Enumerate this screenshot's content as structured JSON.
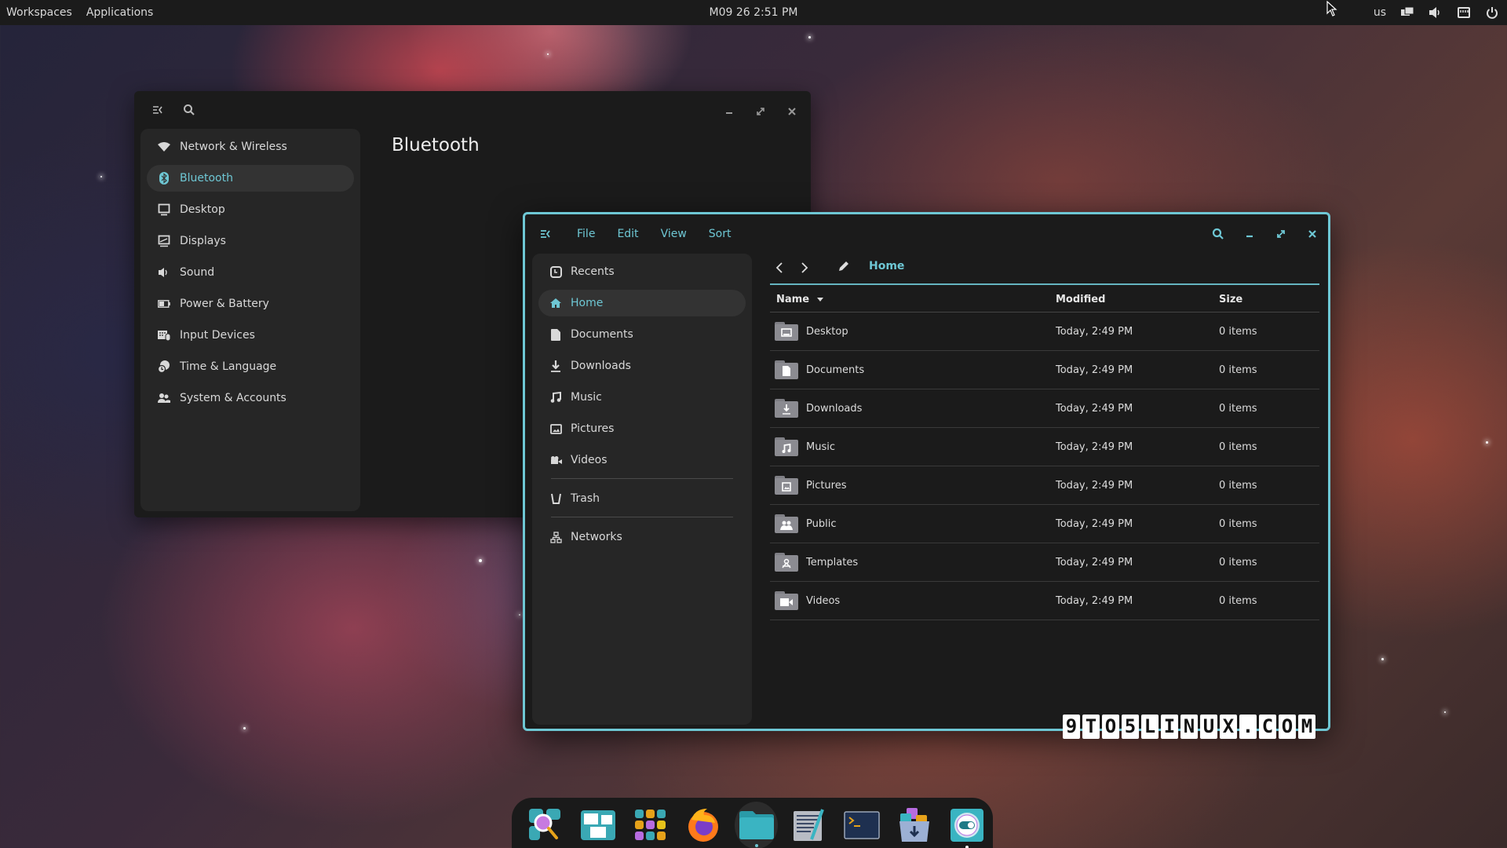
{
  "topbar": {
    "workspaces": "Workspaces",
    "applications": "Applications",
    "clock": "M09 26 2:51 PM",
    "keyboard_layout": "us",
    "tray_icons": [
      "display-icon",
      "volume-icon",
      "network-wired-icon",
      "power-icon"
    ]
  },
  "settings": {
    "page_title": "Bluetooth",
    "header_icons": [
      "sidebar-toggle-icon",
      "search-icon"
    ],
    "window_controls": [
      "minimize",
      "maximize",
      "close"
    ],
    "nav": [
      {
        "label": "Network & Wireless",
        "icon": "wifi-icon",
        "active": false
      },
      {
        "label": "Bluetooth",
        "icon": "bluetooth-icon",
        "active": true
      },
      {
        "label": "Desktop",
        "icon": "monitor-icon",
        "active": false
      },
      {
        "label": "Displays",
        "icon": "display-icon",
        "active": false
      },
      {
        "label": "Sound",
        "icon": "speaker-icon",
        "active": false
      },
      {
        "label": "Power & Battery",
        "icon": "battery-icon",
        "active": false
      },
      {
        "label": "Input Devices",
        "icon": "keyboard-mouse-icon",
        "active": false
      },
      {
        "label": "Time & Language",
        "icon": "globe-clock-icon",
        "active": false
      },
      {
        "label": "System & Accounts",
        "icon": "users-icon",
        "active": false
      }
    ]
  },
  "files": {
    "menu": [
      "File",
      "Edit",
      "View",
      "Sort"
    ],
    "sidebar": {
      "group1": [
        {
          "label": "Recents",
          "icon": "clock-icon",
          "active": false
        },
        {
          "label": "Home",
          "icon": "home-icon",
          "active": true
        },
        {
          "label": "Documents",
          "icon": "document-icon",
          "active": false
        },
        {
          "label": "Downloads",
          "icon": "download-icon",
          "active": false
        },
        {
          "label": "Music",
          "icon": "music-icon",
          "active": false
        },
        {
          "label": "Pictures",
          "icon": "picture-icon",
          "active": false
        },
        {
          "label": "Videos",
          "icon": "video-icon",
          "active": false
        }
      ],
      "group2": [
        {
          "label": "Trash",
          "icon": "trash-icon"
        }
      ],
      "group3": [
        {
          "label": "Networks",
          "icon": "network-icon"
        }
      ]
    },
    "breadcrumb": "Home",
    "columns": {
      "name": "Name",
      "modified": "Modified",
      "size": "Size"
    },
    "rows": [
      {
        "name": "Desktop",
        "modified": "Today, 2:49 PM",
        "size": "0 items",
        "icon": "folder-desktop-icon"
      },
      {
        "name": "Documents",
        "modified": "Today, 2:49 PM",
        "size": "0 items",
        "icon": "folder-documents-icon"
      },
      {
        "name": "Downloads",
        "modified": "Today, 2:49 PM",
        "size": "0 items",
        "icon": "folder-downloads-icon"
      },
      {
        "name": "Music",
        "modified": "Today, 2:49 PM",
        "size": "0 items",
        "icon": "folder-music-icon"
      },
      {
        "name": "Pictures",
        "modified": "Today, 2:49 PM",
        "size": "0 items",
        "icon": "folder-pictures-icon"
      },
      {
        "name": "Public",
        "modified": "Today, 2:49 PM",
        "size": "0 items",
        "icon": "folder-public-icon"
      },
      {
        "name": "Templates",
        "modified": "Today, 2:49 PM",
        "size": "0 items",
        "icon": "folder-templates-icon"
      },
      {
        "name": "Videos",
        "modified": "Today, 2:49 PM",
        "size": "0 items",
        "icon": "folder-videos-icon"
      }
    ]
  },
  "watermark": {
    "chars": [
      "9",
      "T",
      "O",
      "5",
      "L",
      "I",
      "N",
      "U",
      "X",
      ".",
      "C",
      "O",
      "M"
    ]
  },
  "dock": {
    "items": [
      {
        "name": "launcher",
        "running": false
      },
      {
        "name": "workspaces",
        "running": false
      },
      {
        "name": "applications",
        "running": false
      },
      {
        "name": "firefox",
        "running": false
      },
      {
        "name": "files",
        "running": true
      },
      {
        "name": "text-editor",
        "running": false
      },
      {
        "name": "terminal",
        "running": false
      },
      {
        "name": "app-store",
        "running": false
      },
      {
        "name": "settings",
        "running": true
      }
    ]
  },
  "colors": {
    "accent": "#6ec7d4",
    "window_bg": "#1b1b1b",
    "sidebar_bg": "#262626"
  }
}
